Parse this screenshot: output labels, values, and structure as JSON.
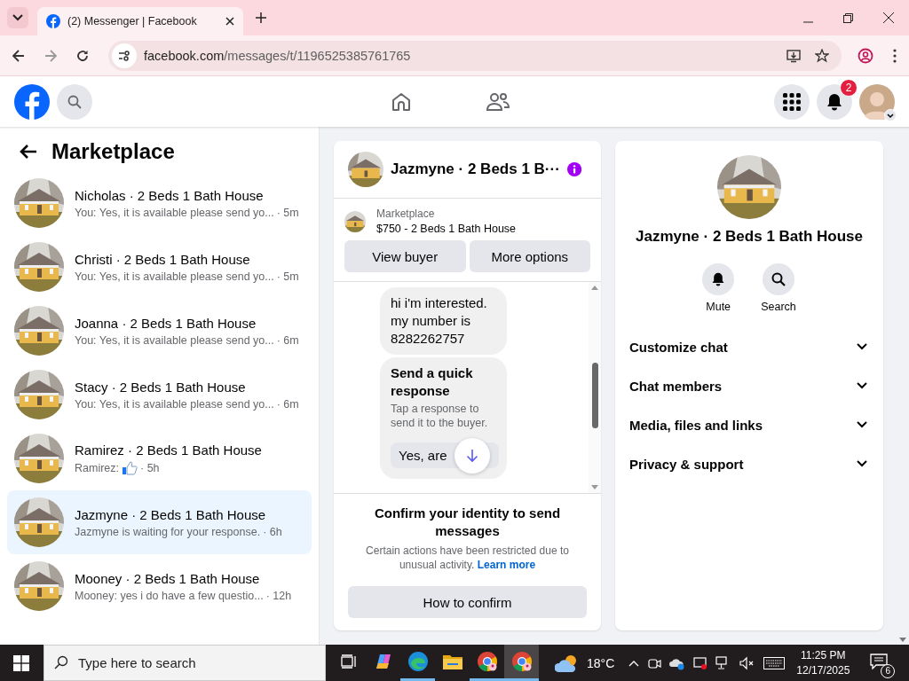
{
  "browser": {
    "tabs": [
      {
        "title": "(2) Messenger | Facebook",
        "selected": true
      }
    ],
    "url": {
      "domain": "facebook.com",
      "path": "/messages/t/1196525385761765"
    }
  },
  "header": {
    "notification_count": "2"
  },
  "sidebar": {
    "title": "Marketplace",
    "conversations": [
      {
        "name": "Nicholas · 2 Beds 1 Bath House",
        "kind": "text",
        "preview": "You: Yes, it is available please send yo...",
        "time": "· 5m",
        "selected": false
      },
      {
        "name": "Christi · 2 Beds 1 Bath House",
        "kind": "text",
        "preview": "You: Yes, it is available please send yo...",
        "time": "· 5m",
        "selected": false
      },
      {
        "name": "Joanna · 2 Beds 1 Bath House",
        "kind": "text",
        "preview": "You: Yes, it is available please send yo...",
        "time": "· 6m",
        "selected": false
      },
      {
        "name": "Stacy · 2 Beds 1 Bath House",
        "kind": "text",
        "preview": "You: Yes, it is available please send yo...",
        "time": "· 6m",
        "selected": false
      },
      {
        "name": "Ramirez · 2 Beds 1 Bath House",
        "kind": "like",
        "preview": "Ramirez:",
        "time": "· 5h",
        "selected": false
      },
      {
        "name": "Jazmyne · 2 Beds 1 Bath House",
        "kind": "text",
        "preview": "Jazmyne is waiting for your response.",
        "time": "· 6h",
        "selected": true
      },
      {
        "name": "Mooney · 2 Beds 1 Bath House",
        "kind": "text",
        "preview": "Mooney: yes i do have a few questio...",
        "time": "· 12h",
        "selected": false
      }
    ]
  },
  "chat": {
    "title": "Jazmyne · 2 Beds 1 B···",
    "listing": {
      "source": "Marketplace",
      "title": "$750 - 2 Beds 1 Bath House"
    },
    "buttons": [
      "View buyer",
      "More options"
    ],
    "messages": [
      {
        "kind": "text",
        "text": "hi i'm interested. my number is 8282262757"
      },
      {
        "kind": "quick_response",
        "title": "Send a quick response",
        "hint": "Tap a response to send it to the buyer.",
        "option": "Yes, are"
      }
    ],
    "notice": {
      "title": "Confirm your identity to send messages",
      "body": "Certain actions have been restricted due to unusual activity.",
      "link": "Learn more",
      "button": "How to confirm"
    }
  },
  "details": {
    "title": "Jazmyne · 2 Beds 1 Bath House",
    "actions": [
      {
        "kind": "mute",
        "label": "Mute"
      },
      {
        "kind": "search",
        "label": "Search"
      }
    ],
    "sections": [
      "Customize chat",
      "Chat members",
      "Media, files and links",
      "Privacy & support"
    ]
  },
  "taskbar": {
    "search_placeholder": "Type here to search",
    "apps": [
      {
        "kind": "taskview",
        "running": false,
        "selected": false
      },
      {
        "kind": "copilot",
        "running": false,
        "selected": false
      },
      {
        "kind": "edge",
        "running": true,
        "selected": false
      },
      {
        "kind": "folder",
        "running": false,
        "selected": false
      },
      {
        "kind": "chrome",
        "running": true,
        "selected": false
      },
      {
        "kind": "chrome",
        "running": true,
        "selected": true
      }
    ],
    "temperature": "18°C",
    "time": "11:25 PM",
    "date": "12/17/2025",
    "notification_count": "6"
  }
}
